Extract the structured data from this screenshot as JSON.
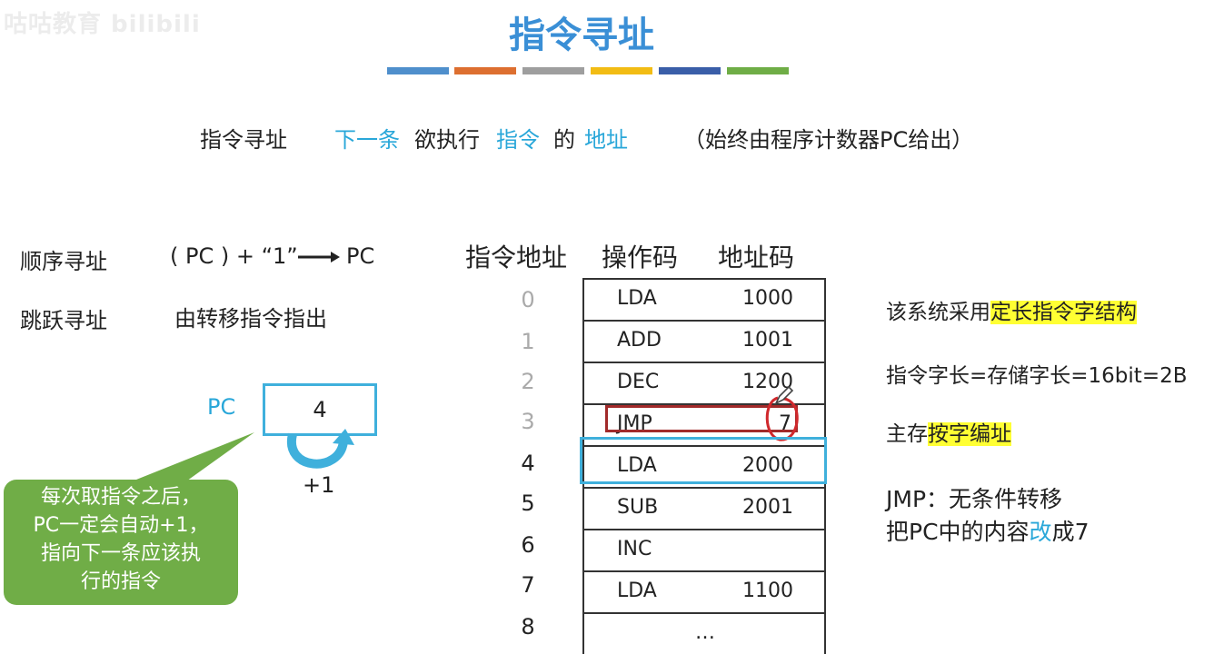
{
  "watermark": "咕咕教育 bilibili",
  "title": "指令寻址",
  "colors": {
    "bars": [
      "#4f8fcc",
      "#dd6f30",
      "#9e9e9e",
      "#f2bc14",
      "#3a5ea8",
      "#6fad46"
    ],
    "accent_blue": "#29a7d9",
    "callout_green": "#70ad47",
    "highlight_yellow": "#ffff33",
    "jmp_border": "#a12a2a",
    "current_row_border": "#3fb0dc"
  },
  "subtitle": {
    "term": "指令寻址",
    "part1": "下一条",
    "part2": "欲执行",
    "part3": "指令",
    "part4": "的",
    "part5": "地址",
    "note": "（始终由程序计数器PC给出）"
  },
  "left": {
    "seq_label": "顺序寻址",
    "seq_formula": "( PC ) + “1”",
    "seq_target": "PC",
    "jump_label": "跳跃寻址",
    "jump_desc": "由转移指令指出",
    "pc_label": "PC",
    "pc_value": "4",
    "increment": "+1",
    "callout": [
      "每次取指令之后，",
      "PC一定会自动+1，",
      "指向下一条应该执",
      "行的指令"
    ]
  },
  "memory": {
    "headers": {
      "address": "指令地址",
      "opcode": "操作码",
      "addrcode": "地址码"
    },
    "rows": [
      {
        "addr": "0",
        "op": "LDA",
        "code": "1000"
      },
      {
        "addr": "1",
        "op": "ADD",
        "code": "1001"
      },
      {
        "addr": "2",
        "op": "DEC",
        "code": "1200"
      },
      {
        "addr": "3",
        "op": "JMP",
        "code": "7"
      },
      {
        "addr": "4",
        "op": "LDA",
        "code": "2000"
      },
      {
        "addr": "5",
        "op": "SUB",
        "code": "2001"
      },
      {
        "addr": "6",
        "op": "INC",
        "code": ""
      },
      {
        "addr": "7",
        "op": "LDA",
        "code": "1100"
      },
      {
        "addr": "8",
        "op": "…",
        "code": ""
      }
    ]
  },
  "notes": {
    "line1_prefix": "该系统采用",
    "line1_highlight": "定长指令字结构",
    "line2": "指令字长=存储字长=16bit=2B",
    "line3_prefix": "主存",
    "line3_highlight": "按字编址",
    "line4": "JMP：无条件转移",
    "line5_prefix": "把PC中的内容",
    "line5_highlight": "改",
    "line5_suffix": "成7"
  }
}
